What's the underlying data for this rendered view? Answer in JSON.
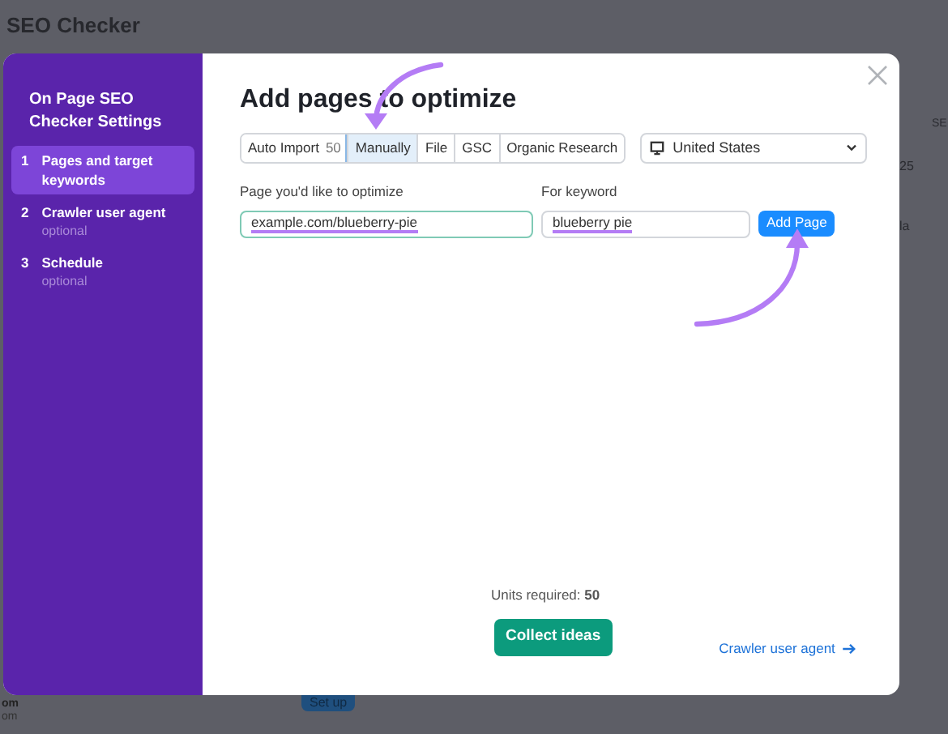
{
  "background": {
    "title": "SEO Checker",
    "column_header": "SE",
    "cells": [
      "25",
      "la"
    ],
    "row_title": "om",
    "row_subtitle": "om",
    "button": "Set up"
  },
  "sidebar": {
    "title": "On Page SEO Checker Settings",
    "steps": [
      {
        "number": "1",
        "label": "Pages and target keywords",
        "selected": true
      },
      {
        "number": "2",
        "label": "Crawler user agent",
        "note": "optional",
        "selected": false
      },
      {
        "number": "3",
        "label": "Schedule",
        "note": "optional",
        "selected": false
      }
    ]
  },
  "dialog": {
    "title": "Add pages to optimize",
    "tabs": [
      {
        "label": "Auto Import",
        "count": "50",
        "selected": false
      },
      {
        "label": "Manually",
        "selected": true
      },
      {
        "label": "File",
        "selected": false
      },
      {
        "label": "GSC",
        "selected": false
      },
      {
        "label": "Organic Research",
        "selected": false
      }
    ],
    "country": {
      "value": "United States"
    },
    "fields": [
      {
        "label": "Page you'd like to optimize",
        "value": "example.com/blueberry-pie",
        "focused": true
      },
      {
        "label": "For keyword",
        "value": "blueberry pie",
        "focused": false
      }
    ],
    "add_button": "Add Page",
    "units": "Units required: **50**",
    "primary_button": "Collect ideas",
    "next_link": "Crawler user agent"
  }
}
